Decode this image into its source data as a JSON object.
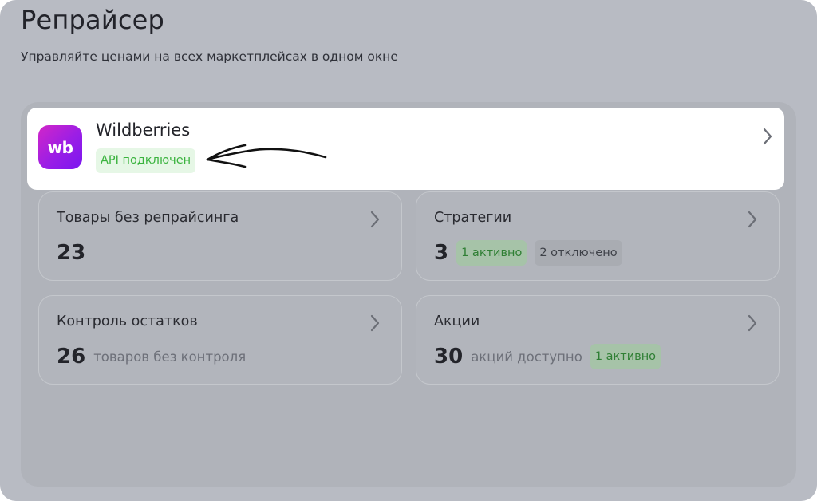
{
  "header": {
    "title": "Репрайсер",
    "subtitle": "Управляйте ценами на всех маркетплейсах в одном окне"
  },
  "marketplace": {
    "logo_text": "wb",
    "name": "Wildberries",
    "status": "API подключен",
    "logo_colors": [
      "#d226c8",
      "#7a16f0"
    ],
    "status_color": "#3ab33e"
  },
  "tiles": {
    "no_repricing": {
      "title": "Товары без репрайсинга",
      "count": "23"
    },
    "strategies": {
      "title": "Стратегии",
      "count": "3",
      "active": "1 активно",
      "disabled": "2 отключено"
    },
    "stock_control": {
      "title": "Контроль остатков",
      "count": "26",
      "note": "товаров без контроля"
    },
    "promos": {
      "title": "Акции",
      "count": "30",
      "note": "акций доступно",
      "active": "1 активно"
    }
  },
  "icons": {
    "chevron": "chevron-right-icon",
    "annotation": "hand-drawn-arrow-icon"
  }
}
